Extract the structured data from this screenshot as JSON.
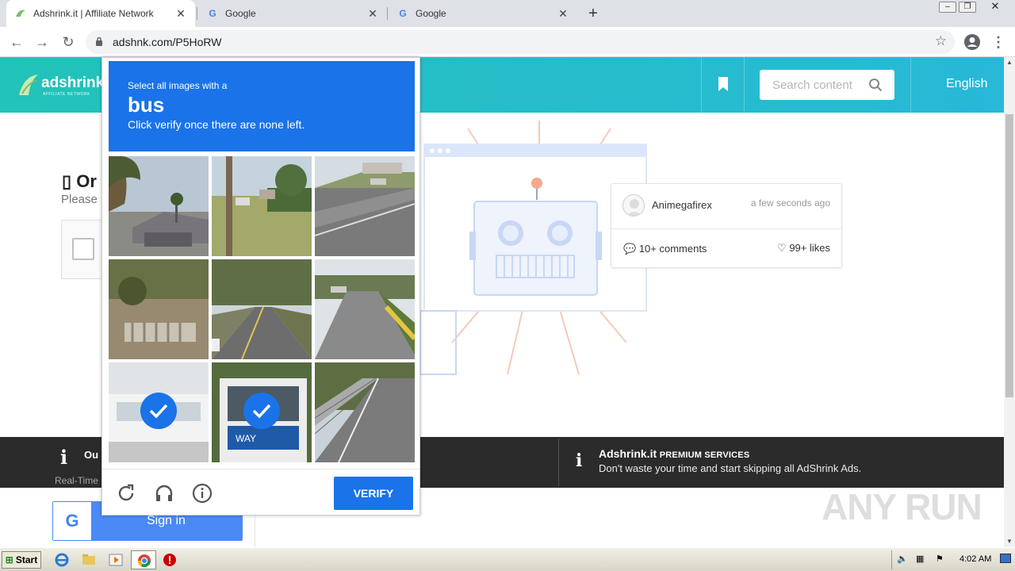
{
  "browser": {
    "tabs": [
      {
        "title": "Adshrink.it | Affiliate Network",
        "active": true
      },
      {
        "title": "Google",
        "active": false
      },
      {
        "title": "Google",
        "active": false
      }
    ],
    "url": "adshnk.com/P5HoRW"
  },
  "site": {
    "logo_text": "adshrink.it",
    "logo_sub": "AFFILIATE NETWORK",
    "search_placeholder": "Search content",
    "language": "English",
    "left_heading": "Or",
    "left_sub": "Please",
    "comment_card": {
      "author": "Animegafirex",
      "time": "a few seconds ago",
      "comments": "10+ comments",
      "likes": "99+ likes"
    },
    "band_left_title": "Ou",
    "band_left_sub": "Real-Time",
    "premium_brand": "Adshrink.it",
    "premium_label": "PREMIUM SERVICES",
    "premium_desc": "Don't waste your time and start skipping all AdShrink Ads.",
    "google_signin": "Sign in",
    "watermark": "ANY RUN"
  },
  "captcha": {
    "prompt": "Select all images with a",
    "target": "bus",
    "instruction": "Click verify once there are none left.",
    "verify_label": "VERIFY",
    "tiles": [
      {
        "scene": "house-palm",
        "selected": false
      },
      {
        "scene": "yard-pole",
        "selected": false
      },
      {
        "scene": "street-intersection",
        "selected": false
      },
      {
        "scene": "dirt-fence",
        "selected": false
      },
      {
        "scene": "road-trees",
        "selected": false
      },
      {
        "scene": "avenue-median",
        "selected": false
      },
      {
        "scene": "bus-side",
        "selected": true
      },
      {
        "scene": "bus-front",
        "selected": true
      },
      {
        "scene": "bridge-road",
        "selected": false
      }
    ]
  },
  "taskbar": {
    "start_label": "Start",
    "clock": "4:02 AM"
  }
}
